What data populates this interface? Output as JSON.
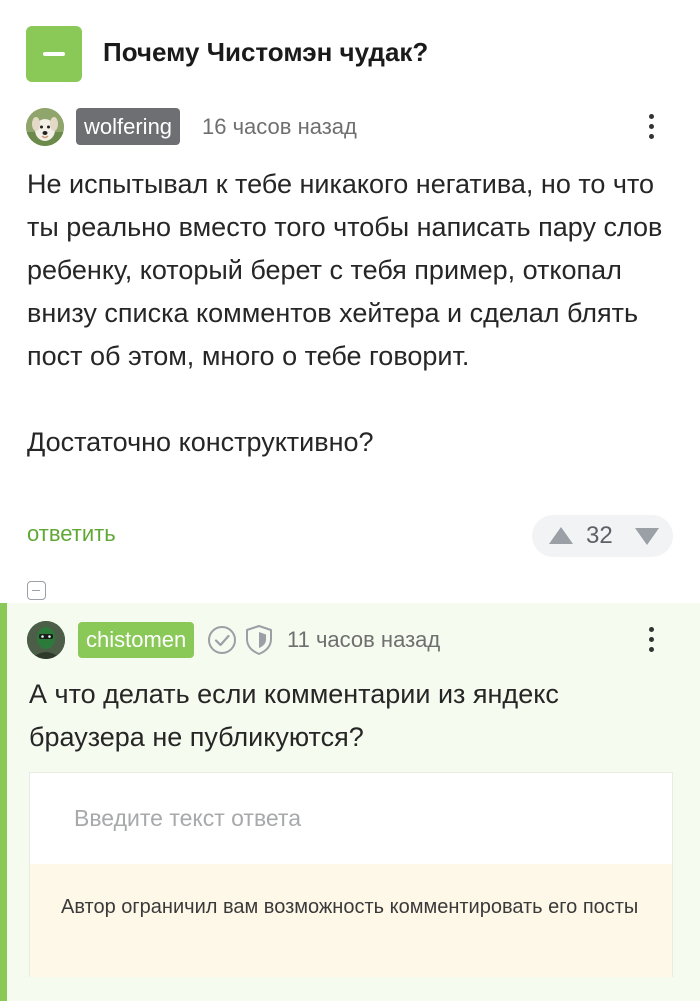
{
  "post": {
    "title": "Почему Чистомэн чудак?"
  },
  "comments": [
    {
      "author": "wolfering",
      "avatar_icon": "dog-avatar",
      "time": "16 часов назад",
      "paragraphs": [
        "Не испытывал к тебе никакого негатива, но то что ты реально вместо того чтобы написать пару слов ребенку, который берет с тебя пример, откопал внизу списка комментов хейтера и сделал блять пост об этом, много о тебе говорит.",
        "Достаточно конструктивно?"
      ],
      "reply_label": "ответить",
      "rating": "32"
    },
    {
      "author": "chistomen",
      "avatar_icon": "masked-person-avatar",
      "badges": [
        "verified-icon",
        "shield-icon"
      ],
      "time": "11 часов назад",
      "text": "А что делать если комментарии из яндекс браузера не публикуются?"
    }
  ],
  "reply_form": {
    "placeholder": "Введите текст ответа",
    "restriction_notice": "Автор ограничил вам возможность комментировать его посты"
  },
  "colors": {
    "accent_green": "#8ac858",
    "link_green": "#60a836",
    "author_badge_gray": "#6d6f72",
    "notice_bg": "#fdf8e8",
    "highlight_bg": "#f5fbef"
  }
}
